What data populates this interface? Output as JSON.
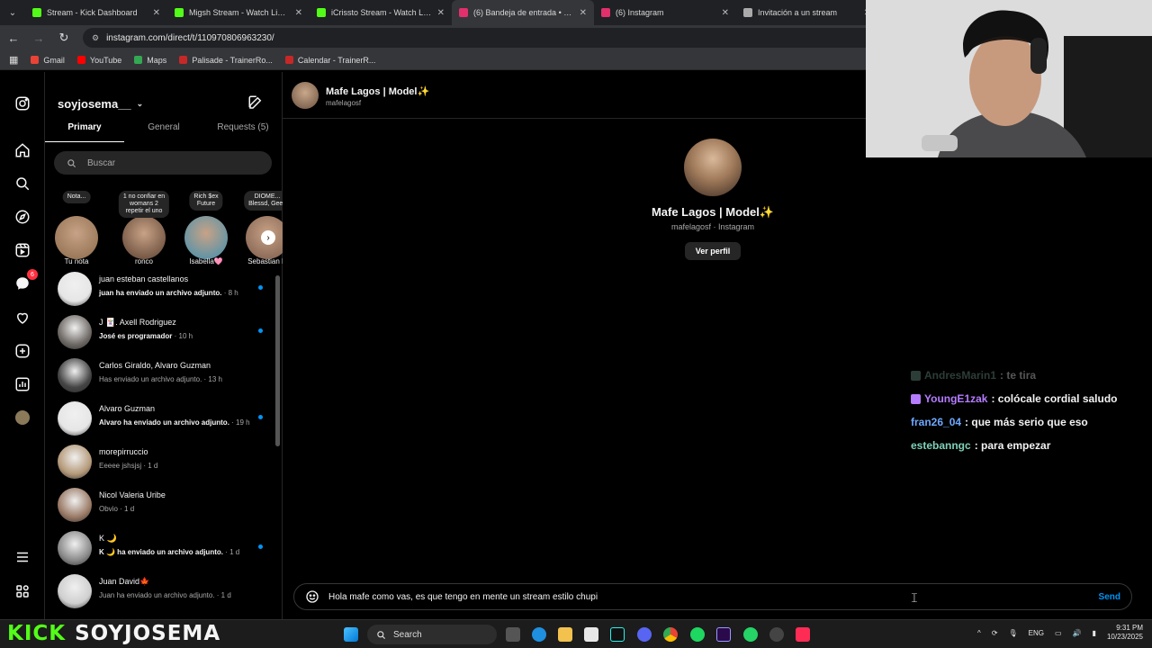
{
  "browser": {
    "tabs": [
      {
        "label": "Stream - Kick Dashboard",
        "color": "#53fc18"
      },
      {
        "label": "Migsh Stream - Watch Live on Kick",
        "color": "#53fc18"
      },
      {
        "label": "iCrissto Stream - Watch Live on Kick",
        "color": "#53fc18"
      },
      {
        "label": "(6) Bandeja de entrada • Chats",
        "color": "#e1306c"
      },
      {
        "label": "(6) Instagram",
        "color": "#e1306c"
      },
      {
        "label": "Invitación a un stream",
        "color": "#aaaaaa"
      }
    ],
    "url": "instagram.com/direct/t/110970806963230/",
    "bookmarks": [
      {
        "label": "Gmail",
        "color": "#ea4335"
      },
      {
        "label": "YouTube",
        "color": "#ff0000"
      },
      {
        "label": "Maps",
        "color": "#34a853"
      },
      {
        "label": "Palisade - TrainerRo...",
        "color": "#c62828"
      },
      {
        "label": "Calendar - TrainerR...",
        "color": "#c62828"
      }
    ]
  },
  "instagram": {
    "rail_icons": [
      "instagram-icon",
      "home-icon",
      "search-icon",
      "explore-icon",
      "reels-icon",
      "messages-icon",
      "notifications-icon",
      "create-icon",
      "dashboard-icon",
      "profile-avatar",
      "menu-icon",
      "more-icon"
    ],
    "messages_badge": "6",
    "username": "soyjosema__",
    "tabs": [
      "Primary",
      "General",
      "Requests (5)"
    ],
    "search_placeholder": "Buscar",
    "notes": [
      {
        "bubble": "Nota...",
        "name": "Tu nota",
        "color": "#8a6a4a"
      },
      {
        "bubble": "1 no confiar en\nwomans 2\nrepetir el uno",
        "name": "ronco",
        "color": "#5a3f2f"
      },
      {
        "bubble": "Rich $ex\nFuture",
        "name": "Isabella🩷",
        "color": "#3e8fb0"
      },
      {
        "bubble": "DIOME...\nBlessd, Geez",
        "name": "Sebastian R",
        "color": "#7a5a4a"
      }
    ],
    "threads": [
      {
        "name": "juan esteban castellanos",
        "preview": "juan ha enviado un archivo adjunto.",
        "time": "· 8 h",
        "unread": true,
        "color": "#e6e6e6"
      },
      {
        "name": "J 🃏. Axell Rodriguez",
        "preview": "José es programador",
        "time": "· 10 h",
        "unread": true,
        "color": "#6f6a66"
      },
      {
        "name": "Carlos Giraldo, Alvaro Guzman",
        "preview": "Has enviado un archivo adjunto.",
        "time": "· 13 h",
        "unread": false,
        "color": "#444"
      },
      {
        "name": "Alvaro Guzman",
        "preview": "Alvaro ha enviado un archivo adjunto.",
        "time": "· 19 h",
        "unread": true,
        "color": "#e6e6e6"
      },
      {
        "name": "morepirruccio",
        "preview": "Eeeee jshsjsj",
        "time": "· 1 d",
        "unread": false,
        "color": "#b59a7a"
      },
      {
        "name": "Nicol Valeria Uribe",
        "preview": "Obvio",
        "time": "· 1 d",
        "unread": false,
        "color": "#9a7a66"
      },
      {
        "name": "K 🌙",
        "preview": "K 🌙 ha enviado un archivo adjunto.",
        "time": "· 1 d",
        "unread": true,
        "color": "#8a8a8a"
      },
      {
        "name": "Juan David🍁",
        "preview": "Juan ha enviado un archivo adjunto.",
        "time": "· 1 d",
        "unread": false,
        "color": "#cfcfcf"
      }
    ],
    "chat": {
      "name": "Mafe Lagos | Model✨",
      "handle": "mafelagosf",
      "profile_sub": "mafelagosf · Instagram",
      "view_profile": "Ver perfil",
      "draft": "Hola mafe como vas, es que tengo en mente un stream estilo chupi",
      "send": "Send"
    }
  },
  "stream_chat": [
    {
      "user": "AndresMarin1",
      "message": ": te tira",
      "color": "#7fb0a0",
      "faded": true
    },
    {
      "user": "YoungE1zak",
      "message": ": colócale cordial saludo",
      "color": "#b57cff",
      "faded": false
    },
    {
      "user": "fran26_04",
      "message": ": que más serio que eso",
      "color": "#6ea8ff",
      "faded": false
    },
    {
      "user": "estebanngc",
      "message": ": para empezar",
      "color": "#7fd1b8",
      "faded": false
    }
  ],
  "stream_brand": {
    "kick": "KICK",
    "channel": "SOYJOSEMA"
  },
  "taskbar": {
    "search": "Search",
    "lang": "ENG",
    "time": "9:31 PM",
    "date": "10/23/2025"
  }
}
